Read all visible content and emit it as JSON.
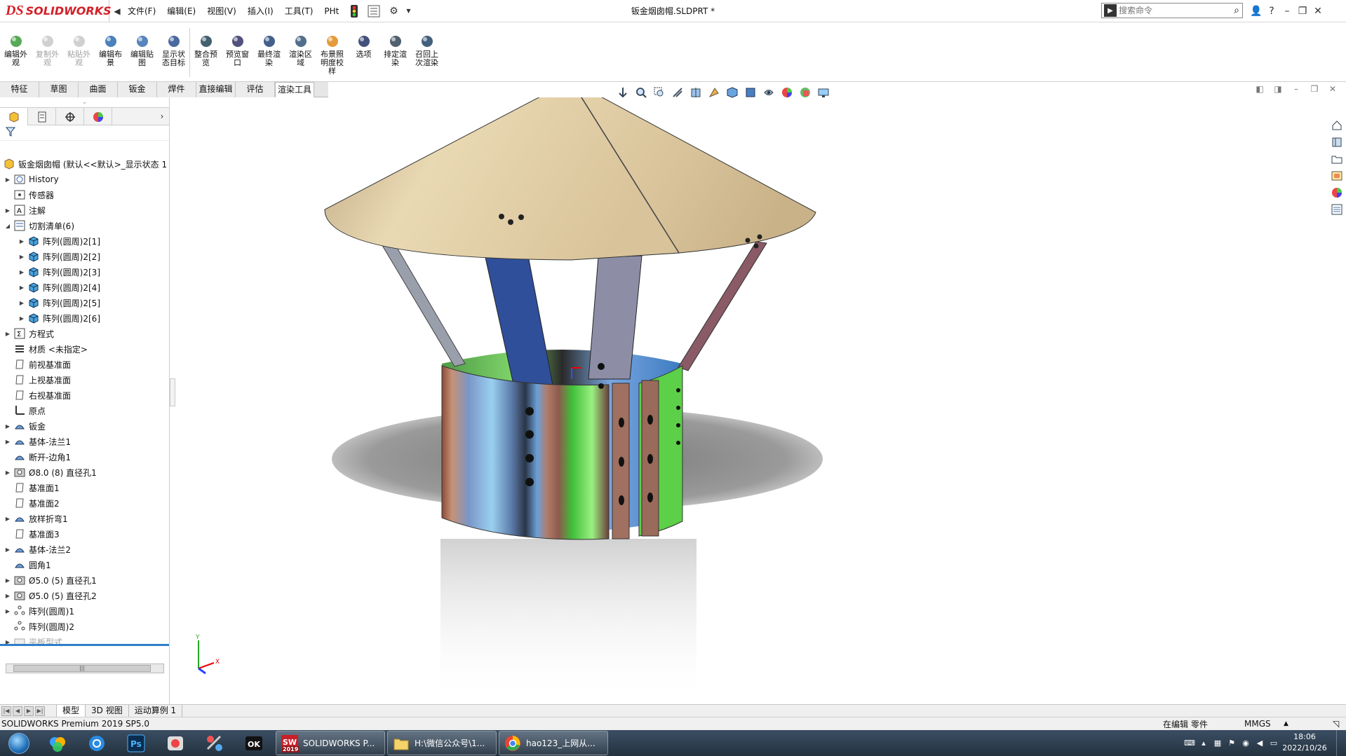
{
  "app": {
    "brand_ds": "DS",
    "brand_name": "SOLIDWORKS",
    "document_title": "钣金烟囱帽.SLDPRT *"
  },
  "menu": {
    "items": [
      "文件(F)",
      "编辑(E)",
      "视图(V)",
      "插入(I)",
      "工具(T)",
      "PHt"
    ]
  },
  "search": {
    "placeholder": "搜索命令"
  },
  "window_controls": [
    "?",
    "–",
    "❐",
    "✕"
  ],
  "ribbon": {
    "buttons": [
      {
        "label": "编辑外观",
        "enabled": true,
        "icon": "edit-appearance-icon"
      },
      {
        "label": "复制外观",
        "enabled": false,
        "icon": "copy-appearance-icon"
      },
      {
        "label": "粘贴外观",
        "enabled": false,
        "icon": "paste-appearance-icon"
      },
      {
        "label": "编辑布景",
        "enabled": true,
        "icon": "edit-scene-icon"
      },
      {
        "label": "编辑贴图",
        "enabled": true,
        "icon": "edit-decal-icon"
      },
      {
        "label": "显示状态目标",
        "enabled": true,
        "icon": "display-state-target-icon"
      },
      {
        "label": "整合预览",
        "enabled": true,
        "icon": "integrated-preview-icon"
      },
      {
        "label": "预览窗口",
        "enabled": true,
        "icon": "preview-window-icon"
      },
      {
        "label": "最终渲染",
        "enabled": true,
        "icon": "final-render-icon"
      },
      {
        "label": "渲染区域",
        "enabled": true,
        "icon": "render-region-icon"
      },
      {
        "label": "布景照明度校样",
        "enabled": true,
        "icon": "scene-illumination-proof-icon"
      },
      {
        "label": "选项",
        "enabled": true,
        "icon": "options-icon"
      },
      {
        "label": "排定渲染",
        "enabled": true,
        "icon": "schedule-render-icon"
      },
      {
        "label": "召回上次渲染",
        "enabled": true,
        "icon": "recall-last-render-icon"
      }
    ]
  },
  "command_tabs": [
    {
      "label": "特征",
      "active": false
    },
    {
      "label": "草图",
      "active": false
    },
    {
      "label": "曲面",
      "active": false
    },
    {
      "label": "钣金",
      "active": false
    },
    {
      "label": "焊件",
      "active": false
    },
    {
      "label": "直接编辑",
      "active": false
    },
    {
      "label": "评估",
      "active": false
    },
    {
      "label": "渲染工具",
      "active": true
    }
  ],
  "feature_tree": {
    "root": "钣金烟囱帽  (默认<<默认>_显示状态 1",
    "items": [
      {
        "label": "History",
        "indent": 0,
        "expander": true,
        "icon": "history-folder-icon"
      },
      {
        "label": "传感器",
        "indent": 0,
        "expander": false,
        "icon": "sensors-icon"
      },
      {
        "label": "注解",
        "indent": 0,
        "expander": true,
        "icon": "annotations-icon"
      },
      {
        "label": "切割清单(6)",
        "indent": 0,
        "expander": true,
        "expanded": true,
        "icon": "cut-list-icon"
      },
      {
        "label": "阵列(圆周)2[1]",
        "indent": 1,
        "expander": true,
        "icon": "solid-body-icon"
      },
      {
        "label": "阵列(圆周)2[2]",
        "indent": 1,
        "expander": true,
        "icon": "solid-body-icon"
      },
      {
        "label": "阵列(圆周)2[3]",
        "indent": 1,
        "expander": true,
        "icon": "solid-body-icon"
      },
      {
        "label": "阵列(圆周)2[4]",
        "indent": 1,
        "expander": true,
        "icon": "solid-body-icon"
      },
      {
        "label": "阵列(圆周)2[5]",
        "indent": 1,
        "expander": true,
        "icon": "solid-body-icon"
      },
      {
        "label": "阵列(圆周)2[6]",
        "indent": 1,
        "expander": true,
        "icon": "solid-body-icon"
      },
      {
        "label": "方程式",
        "indent": 0,
        "expander": true,
        "icon": "equations-icon"
      },
      {
        "label": "材质 <未指定>",
        "indent": 0,
        "expander": false,
        "icon": "material-icon"
      },
      {
        "label": "前视基准面",
        "indent": 0,
        "expander": false,
        "icon": "plane-icon"
      },
      {
        "label": "上视基准面",
        "indent": 0,
        "expander": false,
        "icon": "plane-icon"
      },
      {
        "label": "右视基准面",
        "indent": 0,
        "expander": false,
        "icon": "plane-icon"
      },
      {
        "label": "原点",
        "indent": 0,
        "expander": false,
        "icon": "origin-icon"
      },
      {
        "label": "钣金",
        "indent": 0,
        "expander": true,
        "icon": "sheet-metal-icon"
      },
      {
        "label": "基体-法兰1",
        "indent": 0,
        "expander": true,
        "icon": "base-flange-icon"
      },
      {
        "label": "断开-边角1",
        "indent": 0,
        "expander": false,
        "icon": "break-corner-icon"
      },
      {
        "label": "Ø8.0 (8) 直径孔1",
        "indent": 0,
        "expander": true,
        "icon": "hole-wizard-icon"
      },
      {
        "label": "基准面1",
        "indent": 0,
        "expander": false,
        "icon": "plane-icon"
      },
      {
        "label": "基准面2",
        "indent": 0,
        "expander": false,
        "icon": "plane-icon"
      },
      {
        "label": "放样折弯1",
        "indent": 0,
        "expander": true,
        "icon": "lofted-bend-icon"
      },
      {
        "label": "基准面3",
        "indent": 0,
        "expander": false,
        "icon": "plane-icon"
      },
      {
        "label": "基体-法兰2",
        "indent": 0,
        "expander": true,
        "icon": "base-flange-icon"
      },
      {
        "label": "圆角1",
        "indent": 0,
        "expander": false,
        "icon": "fillet-icon"
      },
      {
        "label": "Ø5.0 (5) 直径孔1",
        "indent": 0,
        "expander": true,
        "icon": "hole-wizard-icon"
      },
      {
        "label": "Ø5.0 (5) 直径孔2",
        "indent": 0,
        "expander": true,
        "icon": "hole-wizard-icon"
      },
      {
        "label": "阵列(圆周)1",
        "indent": 0,
        "expander": true,
        "icon": "circular-pattern-icon"
      },
      {
        "label": "阵列(圆周)2",
        "indent": 0,
        "expander": false,
        "icon": "circular-pattern-icon"
      },
      {
        "label": "平板型式",
        "indent": 0,
        "expander": true,
        "icon": "flat-pattern-icon",
        "grey": true
      }
    ]
  },
  "bottom_tabs": [
    {
      "label": "模型",
      "active": true
    },
    {
      "label": "3D 视图",
      "active": false
    },
    {
      "label": "运动算例 1",
      "active": false
    }
  ],
  "status": {
    "product": "SOLIDWORKS Premium 2019 SP5.0",
    "mode": "在编辑 零件",
    "units": "MMGS"
  },
  "taskbar": {
    "tasks": [
      {
        "label": "SOLIDWORKS P...",
        "icon": "solidworks-taskbar-icon",
        "badge": "2019"
      },
      {
        "label": "H:\\微信公众号\\1...",
        "icon": "folder-taskbar-icon"
      },
      {
        "label": "hao123_上网从...",
        "icon": "browser-taskbar-icon"
      }
    ],
    "clock_time": "18:06",
    "clock_date": "2022/10/26"
  },
  "colors": {
    "brand_red": "#d32027",
    "taskbar_top": "#3a4e63",
    "active_blue": "#2f7ec9"
  }
}
